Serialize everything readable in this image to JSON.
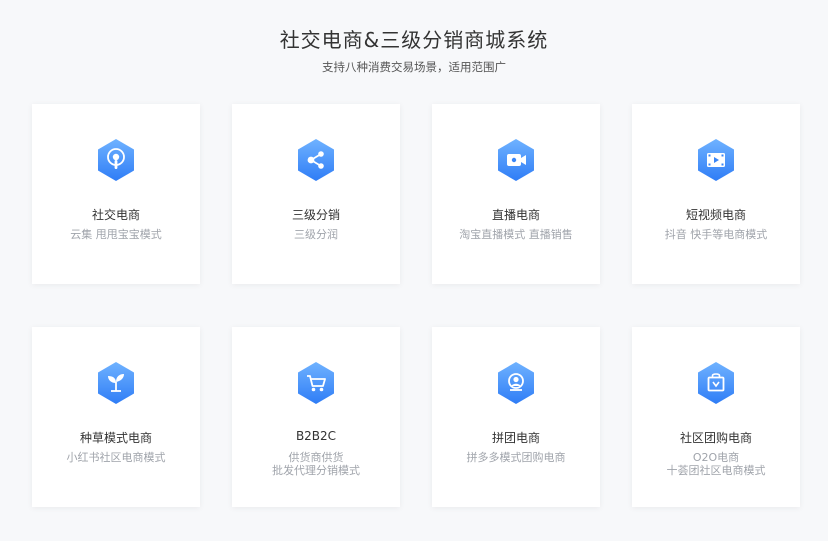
{
  "header": {
    "title": "社交电商&三级分销商城系统",
    "subtitle": "支持八种消费交易场景，适用范围广"
  },
  "colors": {
    "icon_gradient_top": "#6fb2ff",
    "icon_gradient_bottom": "#2f7df6",
    "card_bg": "#ffffff",
    "page_bg": "#f7f8fa",
    "desc_text": "#a0a4ab"
  },
  "cards": [
    {
      "title": "社交电商",
      "desc": [
        "云集 甩甩宝宝模式"
      ],
      "icon": "podcast-icon"
    },
    {
      "title": "三级分销",
      "desc": [
        "三级分润"
      ],
      "icon": "share-icon"
    },
    {
      "title": "直播电商",
      "desc": [
        "淘宝直播模式 直播销售"
      ],
      "icon": "video-camera-icon"
    },
    {
      "title": "短视频电商",
      "desc": [
        "抖音 快手等电商模式"
      ],
      "icon": "film-icon"
    },
    {
      "title": "种草模式电商",
      "desc": [
        "小红书社区电商模式"
      ],
      "icon": "sprout-icon"
    },
    {
      "title": "B2B2C",
      "desc": [
        "供货商供货",
        "批发代理分销模式"
      ],
      "icon": "shopping-cart-icon"
    },
    {
      "title": "拼团电商",
      "desc": [
        "拼多多模式团购电商"
      ],
      "icon": "group-icon"
    },
    {
      "title": "社区团购电商",
      "desc": [
        "O2O电商",
        "十荟团社区电商模式"
      ],
      "icon": "shopping-bag-icon"
    }
  ]
}
